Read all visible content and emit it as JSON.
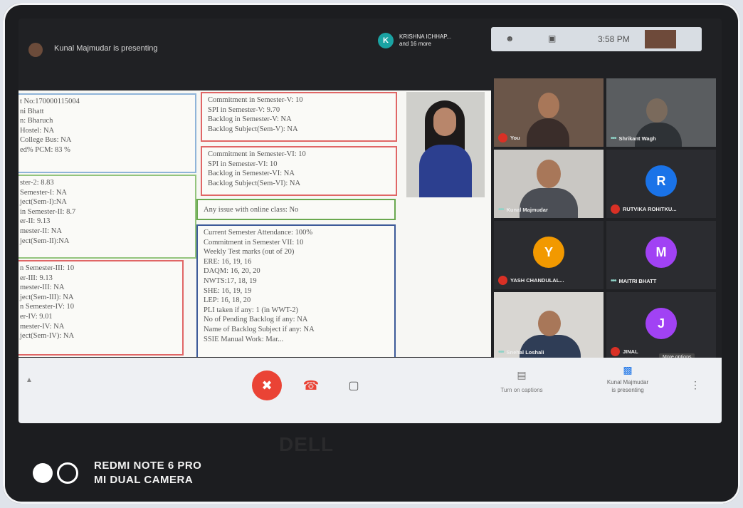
{
  "topbar": {
    "presenting_text": "Kunal Majmudar is presenting",
    "people_badge": "K",
    "people_line1": "KRISHNA ICHHAP...",
    "people_line2": "and 16 more",
    "time": "3:58 PM"
  },
  "slide": {
    "left_top": [
      "t No:170000115004",
      "ni Bhatt",
      "n: Bharuch",
      "Hostel: NA",
      "College Bus: NA",
      "ed% PCM: 83 %"
    ],
    "left_mid": [
      "ster-2: 8.83",
      "Semester-I: NA",
      "ject(Sem-I):NA",
      "in Semester-II: 8.7",
      "er-II: 9.13",
      "mester-II: NA",
      "ject(Sem-II):NA"
    ],
    "left_bottom": [
      "n Semester-III: 10",
      "er-III: 9.13",
      "mester-III: NA",
      "ject(Sem-III): NA",
      "n Semester-IV: 10",
      "er-IV: 9.01",
      "mester-IV: NA",
      "ject(Sem-IV): NA"
    ],
    "sem5": [
      "Commitment in Semester-V: 10",
      "SPI in Semester-V: 9.70",
      "Backlog in Semester-V: NA",
      "Backlog Subject(Sem-V): NA"
    ],
    "sem6": [
      "Commitment in Semester-VI: 10",
      "SPI in Semester-VI: 10",
      "Backlog in Semester-VI: NA",
      "Backlog Subject(Sem-VI): NA"
    ],
    "online_issue": "Any issue with online class: No",
    "current": [
      "Current Semester Attendance: 100%",
      "Commitment in Semester VII: 10",
      "Weekly Test marks (out of 20)",
      "ERE: 16, 19, 16",
      "DAQM: 16, 20, 20",
      "NWTS:17, 18, 19",
      "SHE: 16, 19, 19",
      "LEP: 16, 18, 20",
      "PLI taken if any: 1 (in WWT-2)",
      "No of Pending Backlog if any: NA",
      "Name of Backlog Subject if any: NA",
      "SSIE Manual Work: Mar..."
    ]
  },
  "participants": [
    {
      "name": "You",
      "type": "video"
    },
    {
      "name": "Shrikant Wagh",
      "type": "video"
    },
    {
      "name": "Kunal Majmudar",
      "type": "video"
    },
    {
      "name": "RUTVIKA ROHITKU...",
      "initial": "R",
      "color": "#1a73e8"
    },
    {
      "name": "YASH CHANDULAL...",
      "initial": "Y",
      "color": "#f29900"
    },
    {
      "name": "MAITRI BHATT",
      "initial": "M",
      "color": "#a142f4"
    },
    {
      "name": "Snehal Loshali",
      "type": "video"
    },
    {
      "name": "JINAL",
      "initial": "J",
      "color": "#a142f4"
    }
  ],
  "more_options": "More options",
  "bottombar": {
    "captions_label": "Turn on captions",
    "present_line1": "Kunal Majmudar",
    "present_line2": "is presenting"
  },
  "device": {
    "brand": "DELL",
    "camera_line1": "REDMI NOTE 6 PRO",
    "camera_line2": "MI DUAL CAMERA"
  },
  "colors": {
    "red_box": "#e06666",
    "green_box": "#6aa84f",
    "blue_box": "#3d5a99",
    "mute_red": "#ea4335"
  }
}
